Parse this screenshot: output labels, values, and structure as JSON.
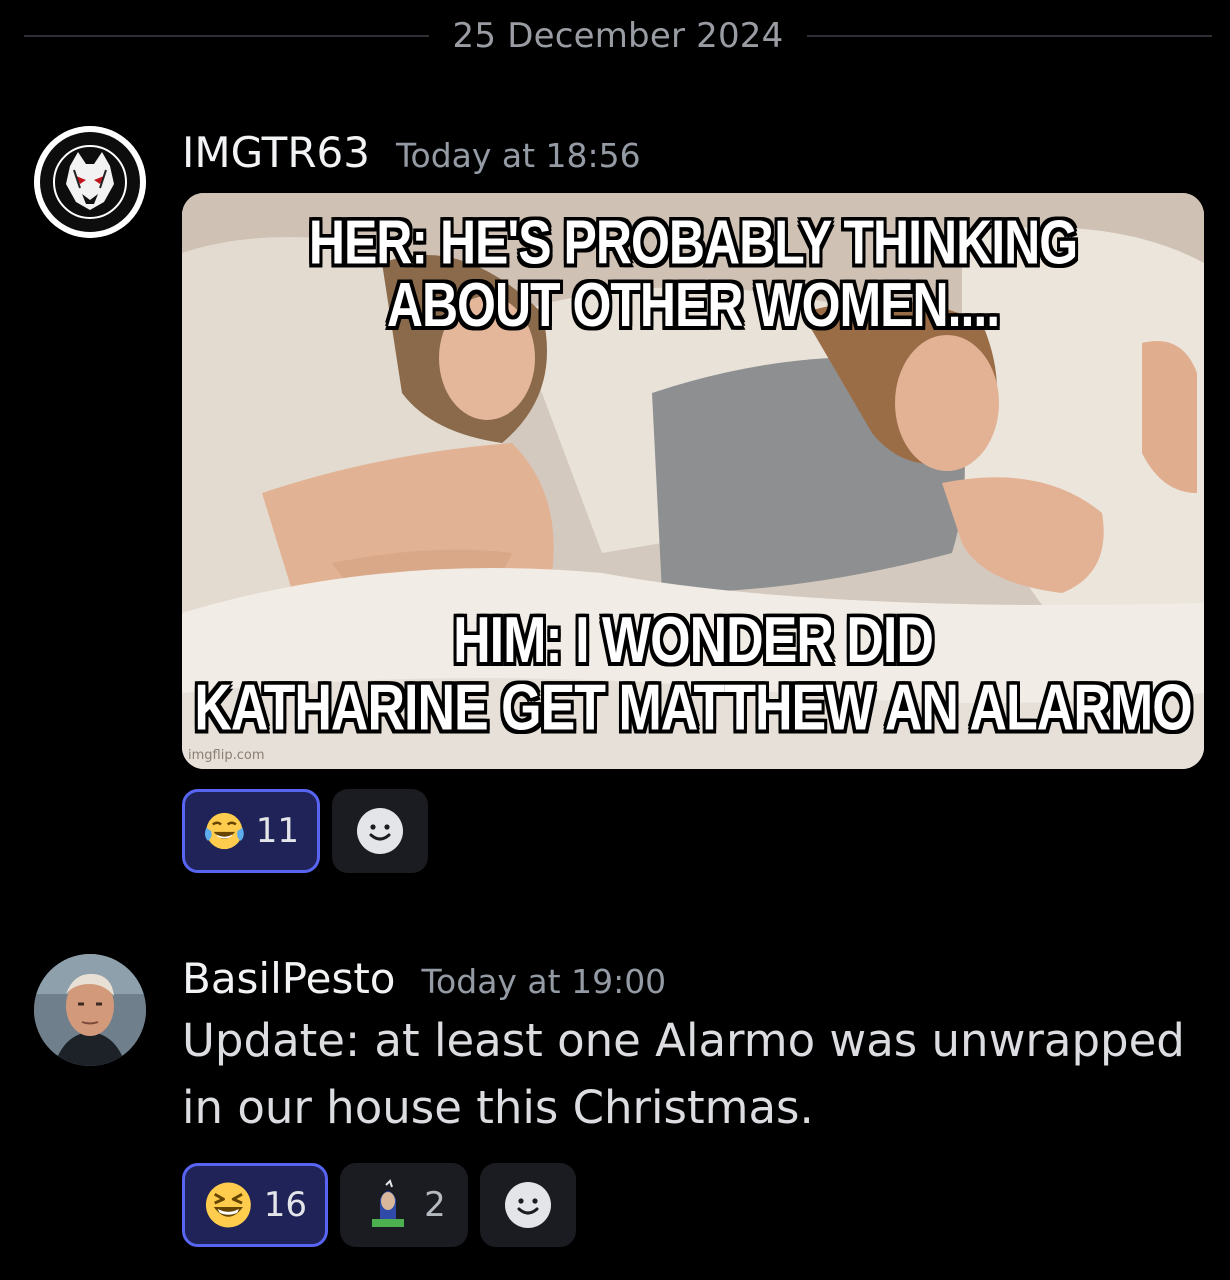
{
  "date_divider": "25 December 2024",
  "messages": [
    {
      "username": "IMGTR63",
      "timestamp": "Today at 18:56",
      "meme": {
        "top_caption_line1": "HER: HE'S PROBABLY THINKING",
        "top_caption_line2": "ABOUT OTHER WOMEN....",
        "bottom_caption_line1": "HIM: I WONDER DID",
        "bottom_caption_line2": "KATHARINE GET MATTHEW AN ALARMO",
        "watermark": "imgflip.com"
      },
      "reactions": [
        {
          "emoji": "joy-emoji",
          "count": "11",
          "active": true
        }
      ]
    },
    {
      "username": "BasilPesto",
      "timestamp": "Today at 19:00",
      "text": "Update: at least one Alarmo was unwrapped in our house this Christmas.",
      "reactions": [
        {
          "emoji": "laughing-emoji",
          "count": "16",
          "active": true
        },
        {
          "emoji": "custom-emoji",
          "count": "2",
          "active": false
        }
      ]
    }
  ],
  "colors": {
    "background": "#000000",
    "accent": "#5865f2",
    "active_reaction_bg": "#1f2357"
  }
}
